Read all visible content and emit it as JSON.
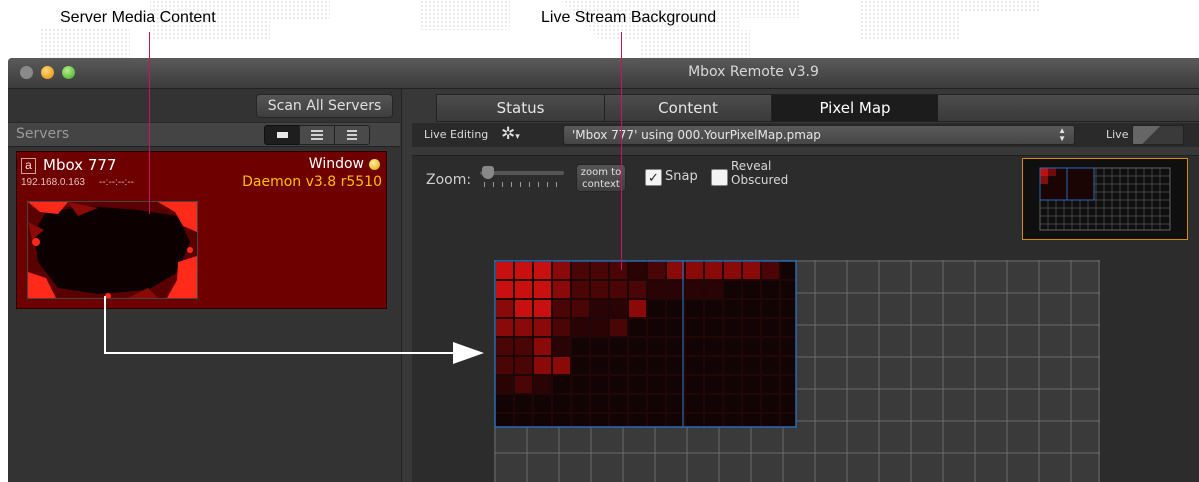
{
  "callouts": {
    "server_media": "Server Media Content",
    "live_stream": "Live Stream Background"
  },
  "window": {
    "title": "Mbox Remote v3.9"
  },
  "left_panel": {
    "scan_button": "Scan All Servers",
    "servers_label": "Servers",
    "server": {
      "badge": "a",
      "name": "Mbox 777",
      "mode": "Window",
      "ip": "192.168.0.163",
      "timecode": "--:--:--:--",
      "daemon": "Daemon v3.8 r5510"
    }
  },
  "tabs": [
    {
      "label": "Status"
    },
    {
      "label": "Content"
    },
    {
      "label": "Pixel Map"
    }
  ],
  "toolbar": {
    "live_editing": "Live Editing",
    "pmap_select": "'Mbox 777' using 000.YourPixelMap.pmap",
    "live_label": "Live"
  },
  "controls": {
    "zoom_label": "Zoom:",
    "zoom_to_context_line1": "zoom to",
    "zoom_to_context_line2": "context",
    "snap_label": "Snap",
    "reveal_line1": "Reveal",
    "reveal_line2": "Obscured",
    "snap_checked": true,
    "reveal_checked": false
  },
  "colors": {
    "server_card": "#6e0000",
    "accent_red": "#cc1010",
    "callout_line": "#c2185b",
    "selection_outline": "#d88a00",
    "daemon_text": "#ffc000"
  }
}
